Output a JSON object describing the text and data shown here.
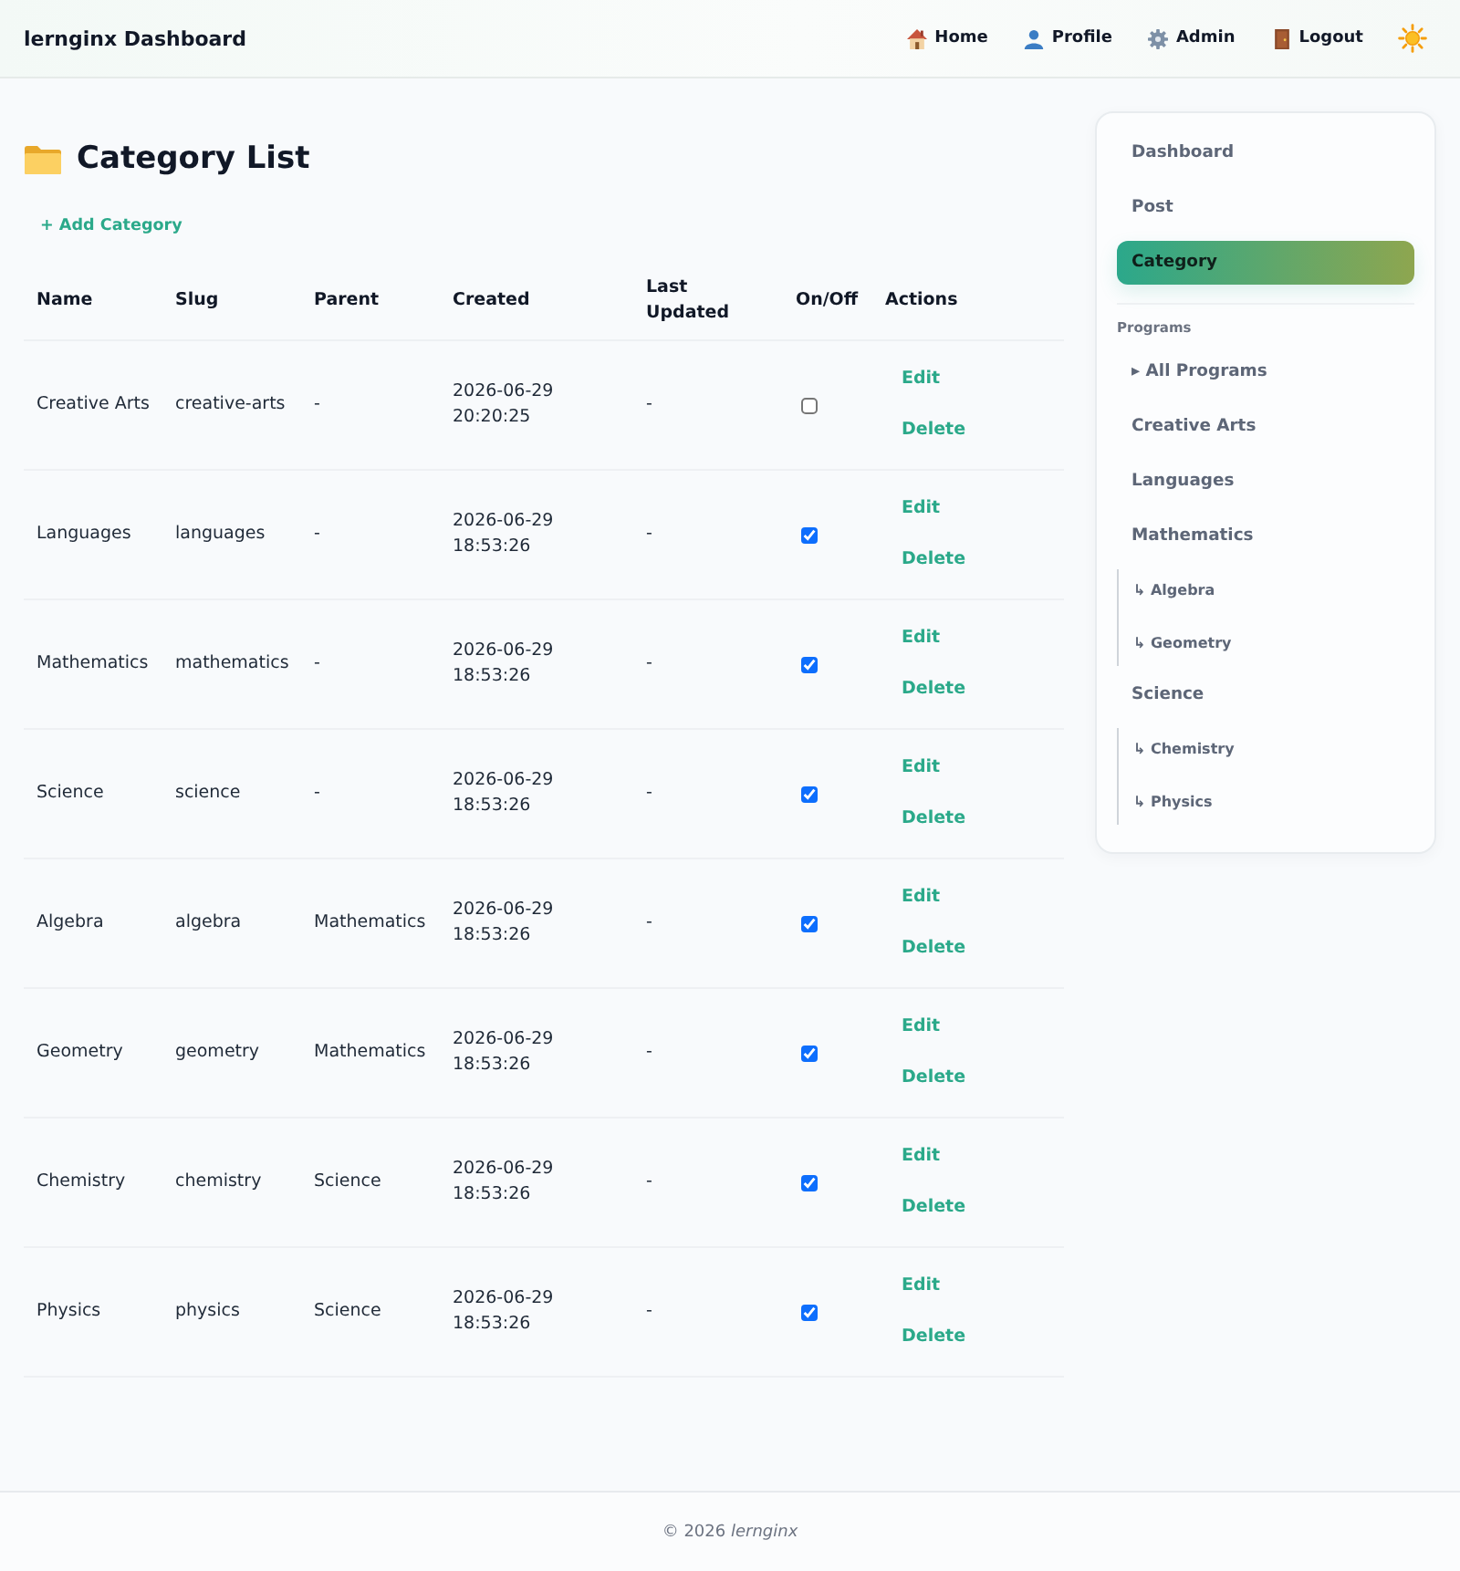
{
  "navbar": {
    "brand": "lernginx Dashboard",
    "links": [
      {
        "label": "Home"
      },
      {
        "label": "Profile"
      },
      {
        "label": "Admin"
      },
      {
        "label": "Logout"
      }
    ]
  },
  "page": {
    "title": "Category List",
    "add_link": "+ Add Category"
  },
  "table": {
    "columns": [
      "Name",
      "Slug",
      "Parent",
      "Created",
      "Last Updated",
      "On/Off",
      "Actions"
    ],
    "rows": [
      {
        "name": "Creative Arts",
        "slug": "creative-arts",
        "parent": "-",
        "created": "2026-06-29 20:20:25",
        "last_updated": "-",
        "on": false,
        "actions": [
          "Edit",
          "Delete"
        ]
      },
      {
        "name": "Languages",
        "slug": "languages",
        "parent": "-",
        "created": "2026-06-29 18:53:26",
        "last_updated": "-",
        "on": true,
        "actions": [
          "Edit",
          "Delete"
        ]
      },
      {
        "name": "Mathematics",
        "slug": "mathematics",
        "parent": "-",
        "created": "2026-06-29 18:53:26",
        "last_updated": "-",
        "on": true,
        "actions": [
          "Edit",
          "Delete"
        ]
      },
      {
        "name": "Science",
        "slug": "science",
        "parent": "-",
        "created": "2026-06-29 18:53:26",
        "last_updated": "-",
        "on": true,
        "actions": [
          "Edit",
          "Delete"
        ]
      },
      {
        "name": "Algebra",
        "slug": "algebra",
        "parent": "Mathematics",
        "created": "2026-06-29 18:53:26",
        "last_updated": "-",
        "on": true,
        "actions": [
          "Edit",
          "Delete"
        ]
      },
      {
        "name": "Geometry",
        "slug": "geometry",
        "parent": "Mathematics",
        "created": "2026-06-29 18:53:26",
        "last_updated": "-",
        "on": true,
        "actions": [
          "Edit",
          "Delete"
        ]
      },
      {
        "name": "Chemistry",
        "slug": "chemistry",
        "parent": "Science",
        "created": "2026-06-29 18:53:26",
        "last_updated": "-",
        "on": true,
        "actions": [
          "Edit",
          "Delete"
        ]
      },
      {
        "name": "Physics",
        "slug": "physics",
        "parent": "Science",
        "created": "2026-06-29 18:53:26",
        "last_updated": "-",
        "on": true,
        "actions": [
          "Edit",
          "Delete"
        ]
      }
    ]
  },
  "sidebar": {
    "items": [
      {
        "label": "Dashboard",
        "selected": false
      },
      {
        "label": "Post",
        "selected": false
      },
      {
        "label": "Category",
        "selected": true
      }
    ],
    "programs": {
      "title": "Programs",
      "items": [
        {
          "label": "▸ All Programs"
        },
        {
          "label": "Creative Arts"
        },
        {
          "label": "Languages"
        },
        {
          "label": "Mathematics",
          "children": [
            {
              "label": "↳ Algebra"
            },
            {
              "label": "↳ Geometry"
            }
          ]
        },
        {
          "label": "Science",
          "children": [
            {
              "label": "↳ Chemistry"
            },
            {
              "label": "↳ Physics"
            }
          ]
        }
      ]
    }
  },
  "footer": {
    "text": "© 2026 *lernginx*"
  }
}
